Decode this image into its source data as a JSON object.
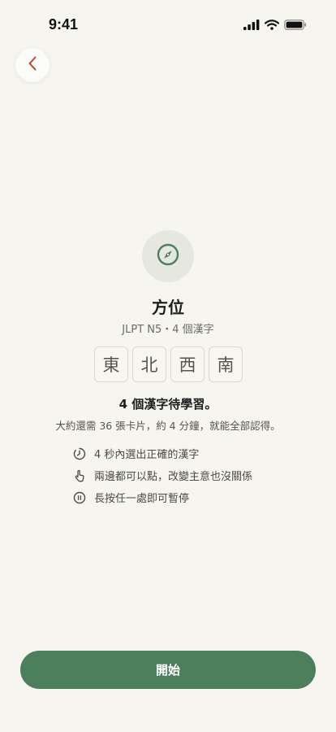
{
  "status_bar": {
    "time": "9:41"
  },
  "header": {
    "back_icon": "chevron-left-icon"
  },
  "lesson": {
    "icon": "compass-icon",
    "title": "方位",
    "subtitle": "JLPT N5・4 個漢字",
    "kanji": [
      "東",
      "北",
      "西",
      "南"
    ],
    "pending_text": "4 個漢字待學習。",
    "estimate_text": "大約還需 36 張卡片，約 4 分鐘，就能全部認得。"
  },
  "tips": [
    {
      "icon": "timer-icon",
      "text": "4 秒內選出正確的漢字"
    },
    {
      "icon": "tap-hand-icon",
      "text": "兩邊都可以點，改變主意也沒關係"
    },
    {
      "icon": "pause-icon",
      "text": "長按任一處即可暫停"
    }
  ],
  "footer": {
    "start_label": "開始"
  },
  "colors": {
    "background": "#f6f5ef",
    "accent": "#4d7f5c",
    "back_chevron": "#b5452f"
  }
}
